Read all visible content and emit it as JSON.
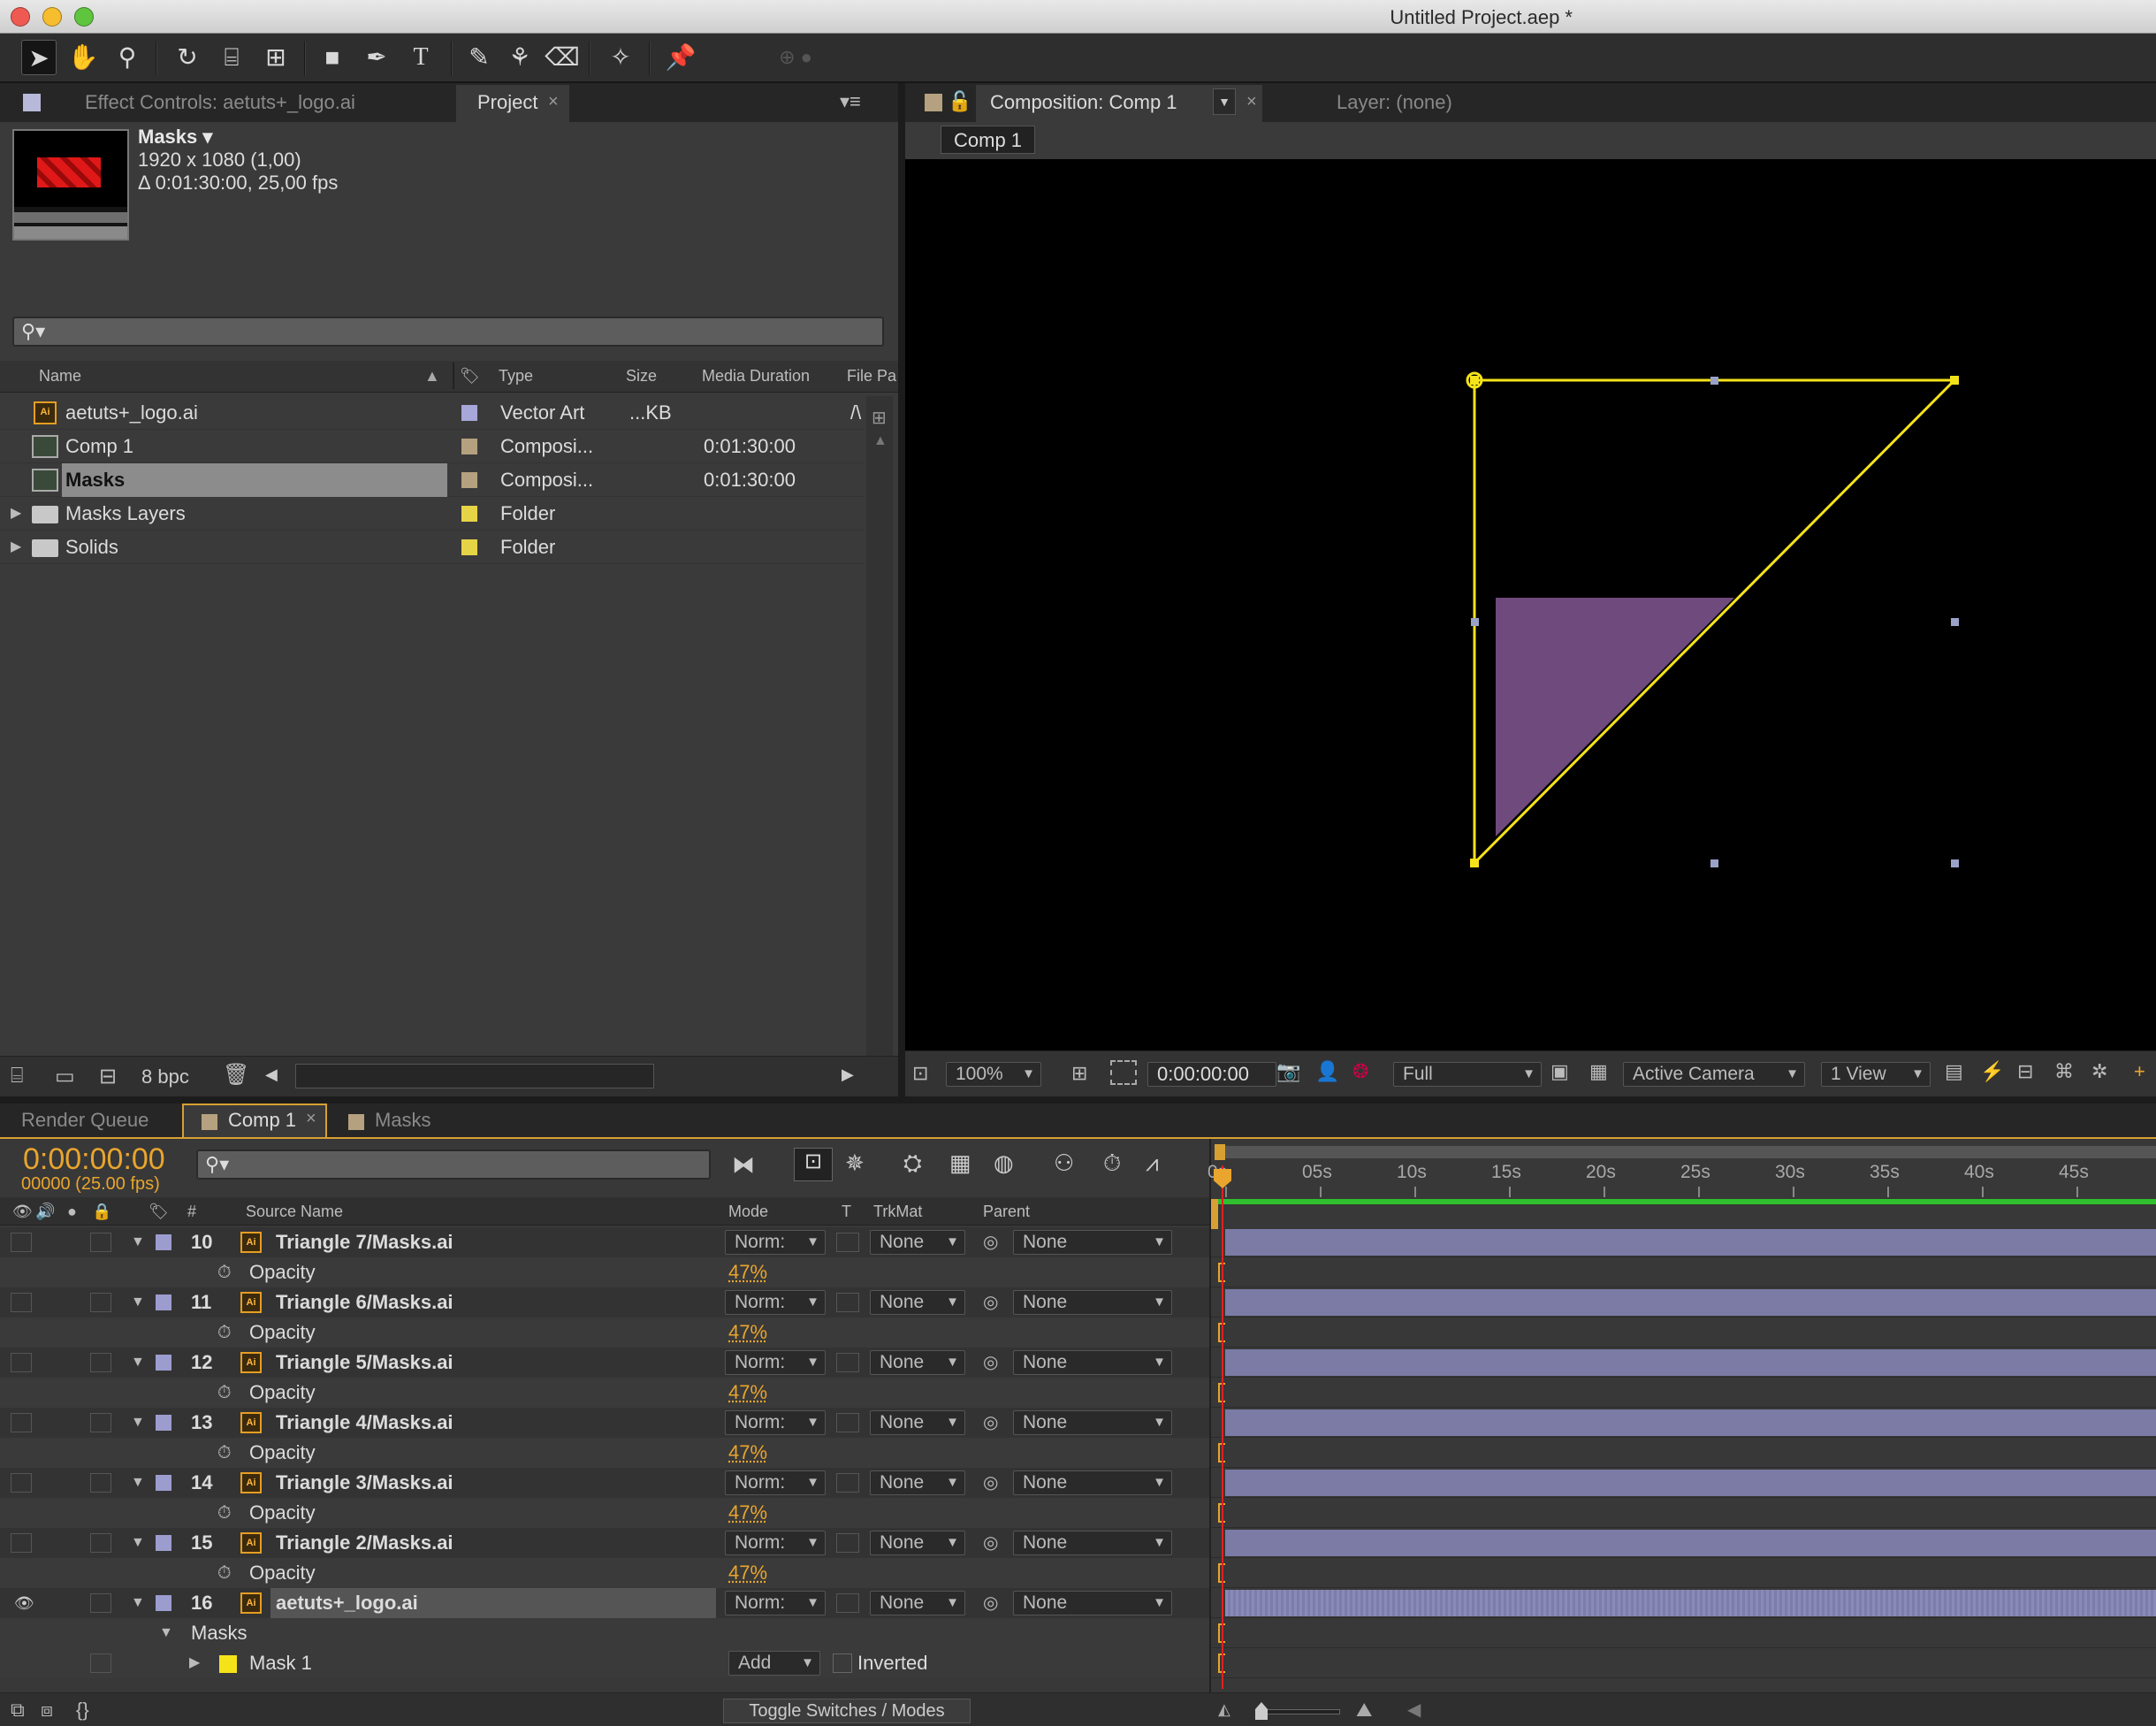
{
  "window": {
    "title": "Untitled Project.aep *"
  },
  "toolbar": {
    "tools": [
      "selection-icon",
      "hand-icon",
      "zoom-icon",
      "rotate-icon",
      "orbit-camera-icon",
      "pan-behind-icon",
      "rectangle-mask-icon",
      "pen-icon",
      "type-icon",
      "brush-icon",
      "clone-stamp-icon",
      "eraser-icon",
      "roto-brush-icon",
      "puppet-pin-icon"
    ]
  },
  "left_panel": {
    "tabs": [
      {
        "label": "Effect Controls: aetuts+_logo.ai"
      },
      {
        "label": "Project"
      }
    ],
    "preview": {
      "name": "Masks ▾",
      "resolution": "1920 x 1080 (1,00)",
      "duration": "Δ 0:01:30:00, 25,00 fps"
    },
    "columns": {
      "name": "Name",
      "type": "Type",
      "size": "Size",
      "duration": "Media Duration",
      "path": "File Pa"
    },
    "items": [
      {
        "name": "aetuts+_logo.ai",
        "type": "Vector Art",
        "size": "...KB",
        "duration": "",
        "path": "/\\",
        "label_color": "#a7a7d9",
        "icon": "ai-file-icon"
      },
      {
        "name": "Comp 1",
        "type": "Composi...",
        "size": "",
        "duration": "0:01:30:00",
        "path": "",
        "label_color": "#b5a17f",
        "icon": "composition-icon"
      },
      {
        "name": "Masks",
        "type": "Composi...",
        "size": "",
        "duration": "0:01:30:00",
        "path": "",
        "label_color": "#b5a17f",
        "icon": "composition-icon"
      },
      {
        "name": "Masks Layers",
        "type": "Folder",
        "size": "",
        "duration": "",
        "path": "",
        "label_color": "#e6d447",
        "icon": "folder-icon"
      },
      {
        "name": "Solids",
        "type": "Folder",
        "size": "",
        "duration": "",
        "path": "",
        "label_color": "#e6d447",
        "icon": "folder-icon"
      }
    ],
    "bpc": "8 bpc"
  },
  "viewer": {
    "tabs": [
      {
        "label": "Composition: Comp 1"
      },
      {
        "label": "Layer: (none)"
      }
    ],
    "breadcrumb": "Comp 1",
    "zoom": "100%",
    "timecode": "0:00:00:00",
    "resolution": "Full",
    "camera": "Active Camera",
    "views": "1 View",
    "mask_color": "#f5e31a",
    "shape_color": "#6f4a7d"
  },
  "timeline": {
    "tabs": [
      {
        "label": "Render Queue"
      },
      {
        "label": "Comp 1"
      },
      {
        "label": "Masks"
      }
    ],
    "current_time": "0:00:00:00",
    "frame_info": "00000 (25.00 fps)",
    "columns": {
      "num": "#",
      "source": "Source Name",
      "mode": "Mode",
      "t": "T",
      "trkmat": "TrkMat",
      "parent": "Parent"
    },
    "ruler": [
      "0s",
      "05s",
      "10s",
      "15s",
      "20s",
      "25s",
      "30s",
      "35s",
      "40s",
      "45s"
    ],
    "layers": [
      {
        "num": "10",
        "name": "Triangle 7/Masks.ai",
        "mode": "Norm:",
        "trkmat": "None",
        "parent": "None",
        "prop": "Opacity",
        "value": "47%"
      },
      {
        "num": "11",
        "name": "Triangle 6/Masks.ai",
        "mode": "Norm:",
        "trkmat": "None",
        "parent": "None",
        "prop": "Opacity",
        "value": "47%"
      },
      {
        "num": "12",
        "name": "Triangle 5/Masks.ai",
        "mode": "Norm:",
        "trkmat": "None",
        "parent": "None",
        "prop": "Opacity",
        "value": "47%"
      },
      {
        "num": "13",
        "name": "Triangle 4/Masks.ai",
        "mode": "Norm:",
        "trkmat": "None",
        "parent": "None",
        "prop": "Opacity",
        "value": "47%"
      },
      {
        "num": "14",
        "name": "Triangle 3/Masks.ai",
        "mode": "Norm:",
        "trkmat": "None",
        "parent": "None",
        "prop": "Opacity",
        "value": "47%"
      },
      {
        "num": "15",
        "name": "Triangle 2/Masks.ai",
        "mode": "Norm:",
        "trkmat": "None",
        "parent": "None",
        "prop": "Opacity",
        "value": "47%"
      }
    ],
    "selected_layer": {
      "num": "16",
      "name": "aetuts+_logo.ai",
      "mode": "Norm:",
      "trkmat": "None",
      "parent": "None"
    },
    "masks_group": "Masks",
    "mask": {
      "name": "Mask 1",
      "mode": "Add",
      "inverted": "Inverted"
    },
    "toggle_label": "Toggle Switches / Modes"
  }
}
